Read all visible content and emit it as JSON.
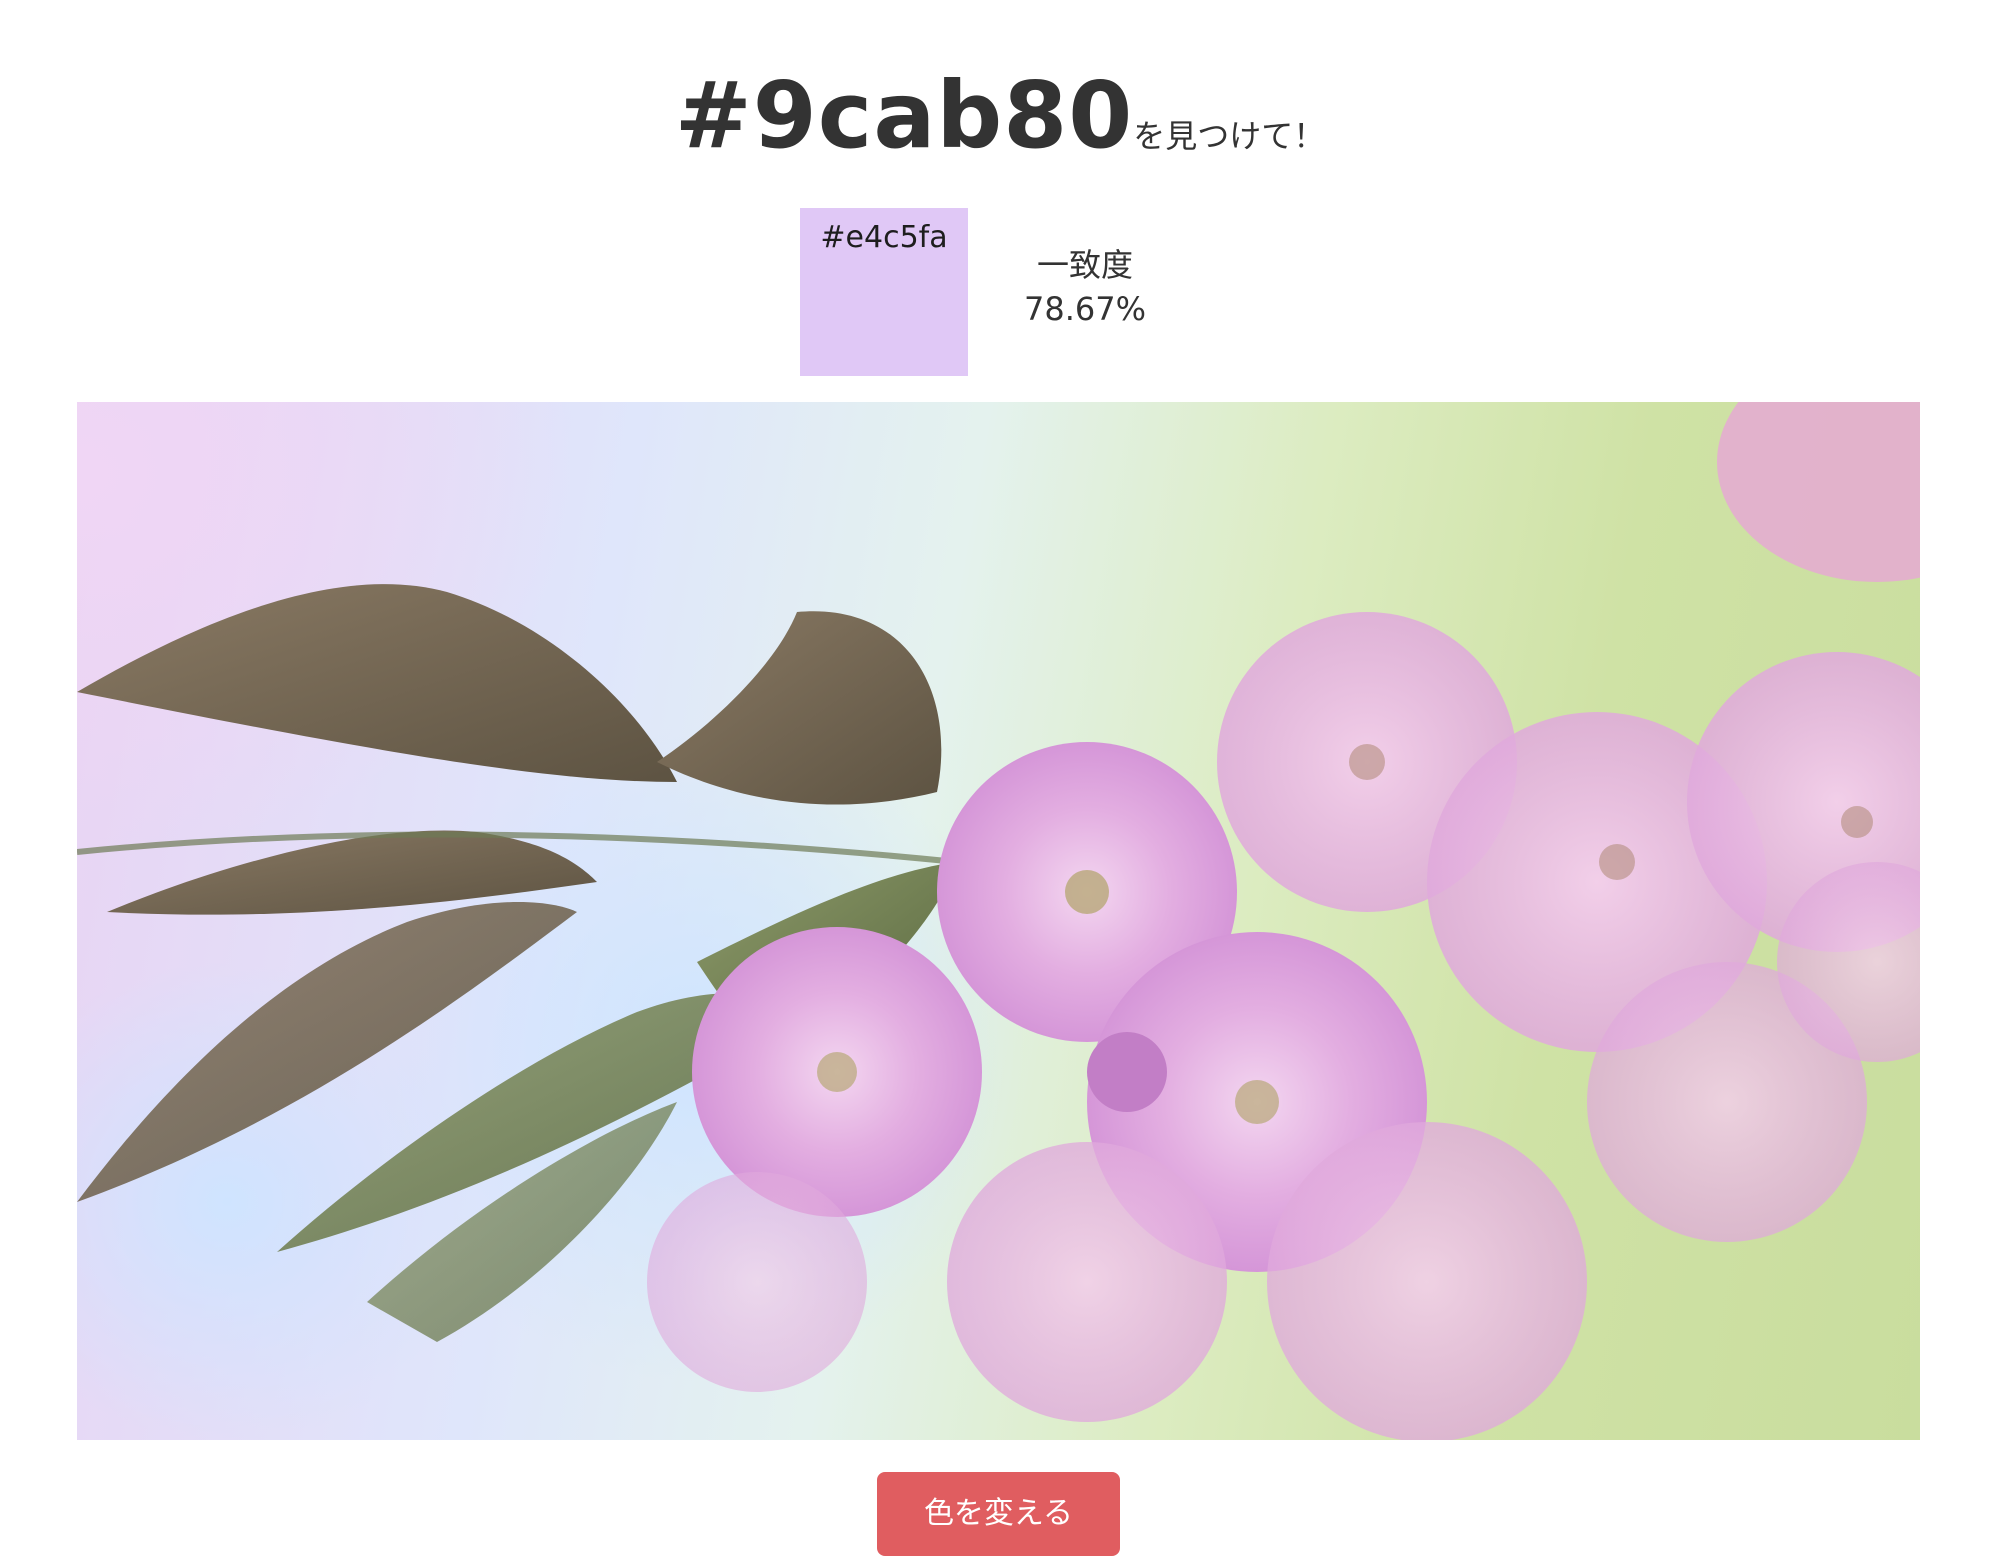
{
  "target": {
    "hex": "#9cab80",
    "suffix": "を見つけて！"
  },
  "picked": {
    "hex": "#e4c5fa",
    "swatch_color": "#e0c8f6"
  },
  "match": {
    "label": "一致度",
    "value": "78.67%"
  },
  "photo": {
    "icon": "cherry-blossom-photo"
  },
  "change_button": {
    "label": "色を変える",
    "color": "#e05d60"
  }
}
